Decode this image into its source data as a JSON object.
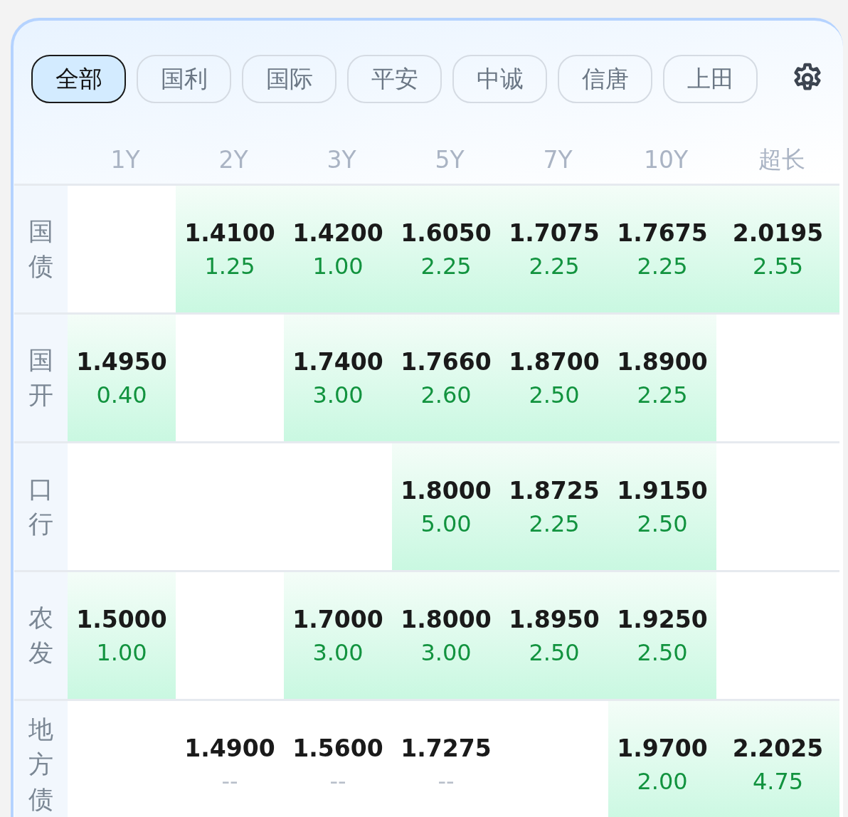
{
  "tabs": [
    {
      "label": "全部",
      "selected": true
    },
    {
      "label": "国利",
      "selected": false
    },
    {
      "label": "国际",
      "selected": false
    },
    {
      "label": "平安",
      "selected": false
    },
    {
      "label": "中诚",
      "selected": false
    },
    {
      "label": "信唐",
      "selected": false
    },
    {
      "label": "上田",
      "selected": false
    }
  ],
  "columns": [
    "1Y",
    "2Y",
    "3Y",
    "5Y",
    "7Y",
    "10Y",
    "超长"
  ],
  "rows": [
    {
      "label": "国债",
      "cells": [
        null,
        {
          "rate": "1.4100",
          "change": "1.25",
          "highlighted": true,
          "change_muted": false
        },
        {
          "rate": "1.4200",
          "change": "1.00",
          "highlighted": true,
          "change_muted": false
        },
        {
          "rate": "1.6050",
          "change": "2.25",
          "highlighted": true,
          "change_muted": false
        },
        {
          "rate": "1.7075",
          "change": "2.25",
          "highlighted": true,
          "change_muted": false
        },
        {
          "rate": "1.7675",
          "change": "2.25",
          "highlighted": true,
          "change_muted": false
        },
        {
          "rate": "2.0195",
          "change": "2.55",
          "highlighted": true,
          "change_muted": false
        }
      ]
    },
    {
      "label": "国开",
      "cells": [
        {
          "rate": "1.4950",
          "change": "0.40",
          "highlighted": true,
          "change_muted": false
        },
        null,
        {
          "rate": "1.7400",
          "change": "3.00",
          "highlighted": true,
          "change_muted": false
        },
        {
          "rate": "1.7660",
          "change": "2.60",
          "highlighted": true,
          "change_muted": false
        },
        {
          "rate": "1.8700",
          "change": "2.50",
          "highlighted": true,
          "change_muted": false
        },
        {
          "rate": "1.8900",
          "change": "2.25",
          "highlighted": true,
          "change_muted": false
        },
        null
      ]
    },
    {
      "label": "口行",
      "cells": [
        null,
        null,
        null,
        {
          "rate": "1.8000",
          "change": "5.00",
          "highlighted": true,
          "change_muted": false
        },
        {
          "rate": "1.8725",
          "change": "2.25",
          "highlighted": true,
          "change_muted": false
        },
        {
          "rate": "1.9150",
          "change": "2.50",
          "highlighted": true,
          "change_muted": false
        },
        null
      ]
    },
    {
      "label": "农发",
      "cells": [
        {
          "rate": "1.5000",
          "change": "1.00",
          "highlighted": true,
          "change_muted": false
        },
        null,
        {
          "rate": "1.7000",
          "change": "3.00",
          "highlighted": true,
          "change_muted": false
        },
        {
          "rate": "1.8000",
          "change": "3.00",
          "highlighted": true,
          "change_muted": false
        },
        {
          "rate": "1.8950",
          "change": "2.50",
          "highlighted": true,
          "change_muted": false
        },
        {
          "rate": "1.9250",
          "change": "2.50",
          "highlighted": true,
          "change_muted": false
        },
        null
      ]
    },
    {
      "label": "地方债",
      "cells": [
        null,
        {
          "rate": "1.4900",
          "change": "--",
          "highlighted": false,
          "change_muted": true
        },
        {
          "rate": "1.5600",
          "change": "--",
          "highlighted": false,
          "change_muted": true
        },
        {
          "rate": "1.7275",
          "change": "--",
          "highlighted": false,
          "change_muted": true
        },
        null,
        {
          "rate": "1.9700",
          "change": "2.00",
          "highlighted": true,
          "change_muted": false
        },
        {
          "rate": "2.2025",
          "change": "4.75",
          "highlighted": true,
          "change_muted": false
        }
      ]
    }
  ]
}
